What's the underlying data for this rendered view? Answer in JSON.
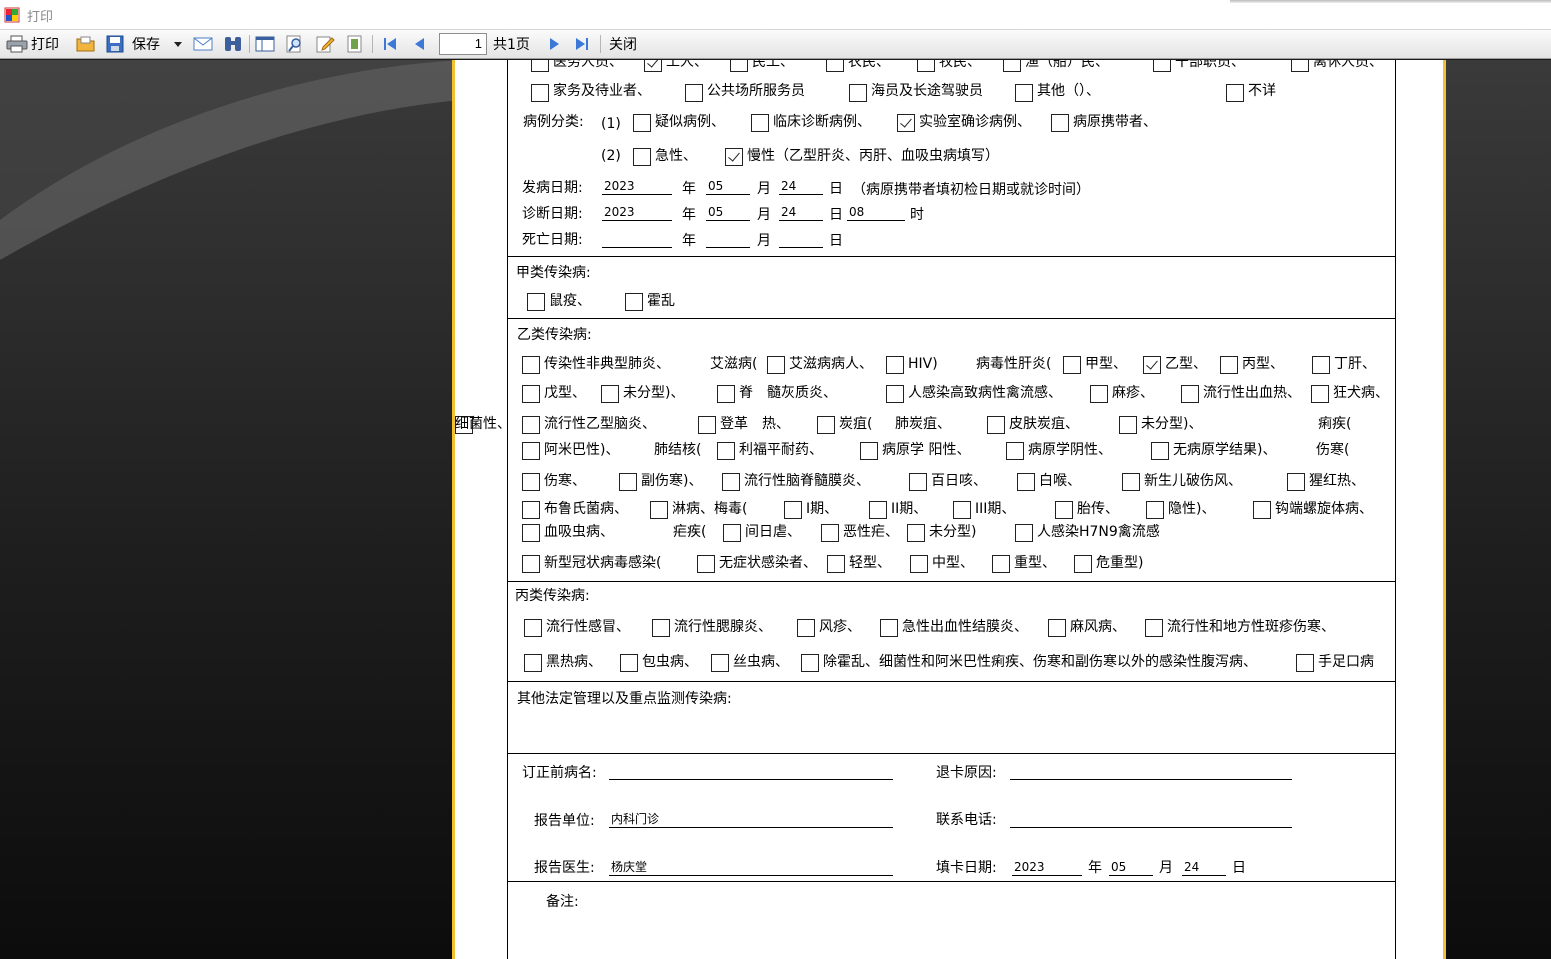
{
  "window": {
    "title": "打印"
  },
  "toolbar": {
    "print": "打印",
    "save": "保存",
    "page": "1",
    "total": "共1页",
    "close": "关闭"
  },
  "icons": [
    "app-icon",
    "printer-icon",
    "open-folder-icon",
    "save-disk-icon",
    "dropdown-arrow-icon",
    "mail-icon",
    "binoculars-search-icon",
    "page-layout-icon",
    "magnify-icon",
    "edit-page-icon",
    "fit-page-icon",
    "first-page-icon",
    "previous-page-icon",
    "next-page-icon",
    "last-page-icon"
  ],
  "colors": {
    "paper_border": "#f2c030",
    "check": "#222222"
  },
  "form": {
    "row_occ1": [
      {
        "t": "医务人员、",
        "c": false
      },
      {
        "t": "工人、",
        "c": true
      },
      {
        "t": "民工、",
        "c": false
      },
      {
        "t": "农民、",
        "c": false
      },
      {
        "t": "牧民、",
        "c": false
      },
      {
        "t": "渔（船）民、",
        "c": false
      },
      {
        "t": "干部职员、",
        "c": false
      },
      {
        "t": "离休人员、",
        "c": false
      }
    ],
    "row_occ2": [
      {
        "t": "家务及待业者、",
        "c": false
      },
      {
        "t": "公共场所服务员",
        "c": false
      },
      {
        "t": "海员及长途驾驶员",
        "c": false
      },
      {
        "t": "其他（）、",
        "c": false
      },
      {
        "t": "不详",
        "c": false
      }
    ],
    "case_label": "病例分类:",
    "case1_prefix": "(1)",
    "case1": [
      {
        "t": "疑似病例、",
        "c": false
      },
      {
        "t": "临床诊断病例、",
        "c": false
      },
      {
        "t": "实验室确诊病例、",
        "c": true
      },
      {
        "t": "病原携带者、",
        "c": false
      }
    ],
    "case2_prefix": "(2)",
    "case2": [
      {
        "t": "急性、",
        "c": false
      },
      {
        "t": "慢性（乙型肝炎、丙肝、血吸虫病填写）",
        "c": true
      }
    ],
    "onset": {
      "label": "发病日期:",
      "year": "2023",
      "month": "05",
      "day": "24",
      "note": "（病原携带者填初检日期或就诊时间）"
    },
    "diagnosis": {
      "label": "诊断日期:",
      "year": "2023",
      "month": "05",
      "day": "24",
      "hour": "08"
    },
    "death": {
      "label": "死亡日期:"
    },
    "unit_year": "年",
    "unit_month": "月",
    "unit_day": "日",
    "unit_hour": "时",
    "class_a": {
      "title": "甲类传染病:",
      "items": [
        {
          "t": "鼠疫、",
          "c": false
        },
        {
          "t": "霍乱",
          "c": false
        }
      ]
    },
    "class_b": {
      "title": "乙类传染病:",
      "rows": [
        [
          {
            "t": "传染性非典型肺炎、",
            "c": false
          },
          {
            "t": "艾滋病(",
            "c": null
          },
          {
            "t": "艾滋病病人、",
            "c": false
          },
          {
            "t": "HIV)",
            "c": false
          },
          {
            "t": "病毒性肝炎(",
            "c": null
          },
          {
            "t": "甲型、",
            "c": false
          },
          {
            "t": "乙型、",
            "c": true
          },
          {
            "t": "丙型、",
            "c": false
          },
          {
            "t": "丁肝、",
            "c": false
          }
        ],
        [
          {
            "t": "戊型、",
            "c": false
          },
          {
            "t": "未分型)、",
            "c": false
          },
          {
            "t": "脊　髓灰质炎、",
            "c": false
          },
          {
            "t": "人感染高致病性禽流感、",
            "c": false
          },
          {
            "t": "麻疹、",
            "c": false
          },
          {
            "t": "流行性出血热、",
            "c": false
          },
          {
            "t": "狂犬病、",
            "c": false
          }
        ],
        [
          {
            "t": "流行性乙型脑炎、",
            "c": false
          },
          {
            "t": "登革　热、",
            "c": false
          },
          {
            "t": "炭疽(",
            "c": false
          },
          {
            "t": "肺炭疽、",
            "c": null
          },
          {
            "t": "皮肤炭疽、",
            "c": false
          },
          {
            "t": "未分型)、",
            "c": false
          },
          {
            "t": "痢疾(",
            "c": null
          },
          {
            "t": "细菌性、",
            "c": false
          }
        ],
        [
          {
            "t": "阿米巴性)、",
            "c": false
          },
          {
            "t": "肺结核(",
            "c": null
          },
          {
            "t": "利福平耐药、",
            "c": false
          },
          {
            "t": "病原学 阳性、",
            "c": false
          },
          {
            "t": "病原学阴性、",
            "c": false
          },
          {
            "t": "无病原学结果)、",
            "c": false
          },
          {
            "t": "伤寒(",
            "c": null
          }
        ],
        [
          {
            "t": "伤寒、",
            "c": false
          },
          {
            "t": "副伤寒)、",
            "c": false
          },
          {
            "t": "流行性脑脊髓膜炎、",
            "c": false
          },
          {
            "t": "百日咳、",
            "c": false
          },
          {
            "t": "白喉、",
            "c": false
          },
          {
            "t": "新生儿破伤风、",
            "c": false
          },
          {
            "t": "猩红热、",
            "c": false
          }
        ],
        [
          {
            "t": "布鲁氏菌病、",
            "c": false
          },
          {
            "t": "淋病、梅毒(",
            "c": false
          },
          {
            "t": "I期、",
            "c": false
          },
          {
            "t": "II期、",
            "c": false
          },
          {
            "t": "III期、",
            "c": false
          },
          {
            "t": "胎传、",
            "c": false
          },
          {
            "t": "隐性)、",
            "c": false
          },
          {
            "t": "钩端螺旋体病、",
            "c": false
          }
        ],
        [
          {
            "t": "血吸虫病、",
            "c": false
          },
          {
            "t": "疟疾(",
            "c": null
          },
          {
            "t": "间日虐、",
            "c": false
          },
          {
            "t": "恶性疟、",
            "c": false
          },
          {
            "t": "未分型)",
            "c": false
          },
          {
            "t": "人感染H7N9禽流感",
            "c": false
          }
        ],
        [
          {
            "t": "新型冠状病毒感染(",
            "c": false
          },
          {
            "t": "无症状感染者、",
            "c": false
          },
          {
            "t": "轻型、",
            "c": false
          },
          {
            "t": "中型、",
            "c": false
          },
          {
            "t": "重型、",
            "c": false
          },
          {
            "t": "危重型)",
            "c": false
          }
        ]
      ]
    },
    "class_c": {
      "title": "丙类传染病:",
      "rows": [
        [
          {
            "t": "流行性感冒、",
            "c": false
          },
          {
            "t": "流行性腮腺炎、",
            "c": false
          },
          {
            "t": "风疹、",
            "c": false
          },
          {
            "t": "急性出血性结膜炎、",
            "c": false
          },
          {
            "t": "麻风病、",
            "c": false
          },
          {
            "t": "流行性和地方性斑疹伤寒、",
            "c": false
          }
        ],
        [
          {
            "t": "黑热病、",
            "c": false
          },
          {
            "t": "包虫病、",
            "c": false
          },
          {
            "t": "丝虫病、",
            "c": false
          },
          {
            "t": "除霍乱、细菌性和阿米巴性痢疾、伤寒和副伤寒以外的感染性腹泻病、",
            "c": false
          },
          {
            "t": "手足口病",
            "c": false
          }
        ]
      ]
    },
    "other": {
      "title": "其他法定管理以及重点监测传染病:"
    },
    "revise_label": "订正前病名:",
    "return_label": "退卡原因:",
    "unit_label": "报告单位:",
    "unit_value": "内科门诊",
    "phone_label": "联系电话:",
    "doctor_label": "报告医生:",
    "doctor_value": "杨庆堂",
    "fill": {
      "label": "填卡日期:",
      "year": "2023",
      "month": "05",
      "day": "24"
    },
    "remark_label": "备注:"
  }
}
